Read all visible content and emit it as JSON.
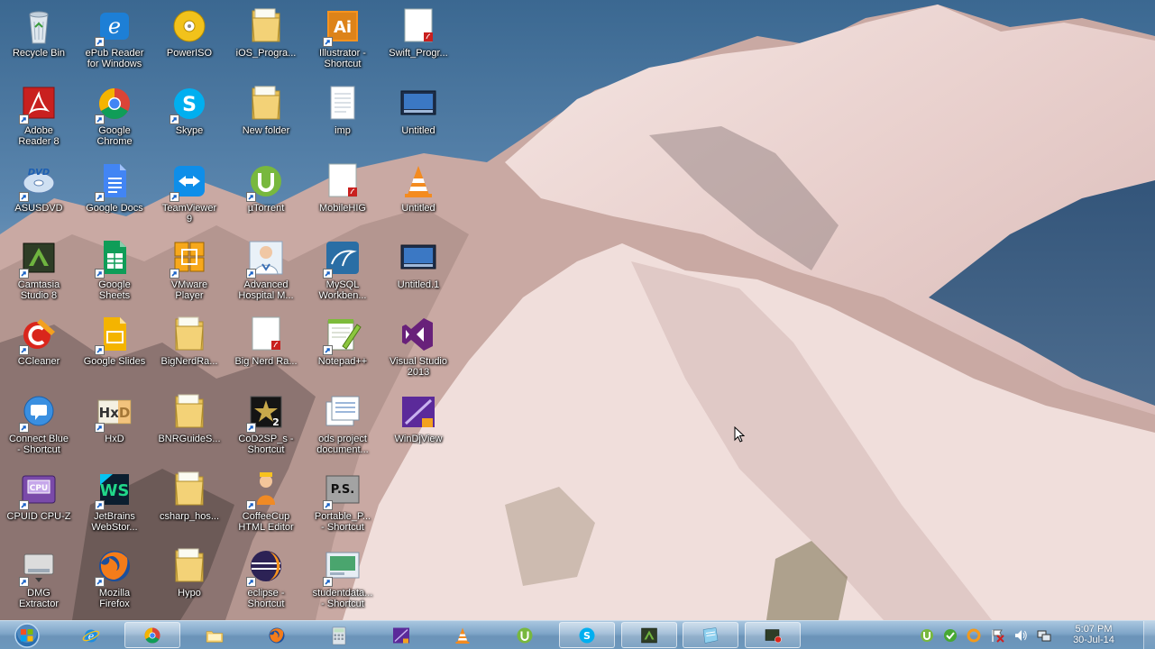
{
  "desktop": {
    "icons": [
      {
        "id": "recycle-bin",
        "label": "Recycle Bin",
        "icon": "recycle-bin-icon",
        "shortcut": false
      },
      {
        "id": "epub-reader",
        "label": "ePub Reader\nfor Windows",
        "icon": "epub-reader-icon",
        "shortcut": true
      },
      {
        "id": "poweriso",
        "label": "PowerISO",
        "icon": "poweriso-icon",
        "shortcut": false
      },
      {
        "id": "ios-programming",
        "label": "iOS_Progra...",
        "icon": "folder-icon",
        "shortcut": false
      },
      {
        "id": "illustrator",
        "label": "Illustrator -\nShortcut",
        "icon": "illustrator-icon",
        "shortcut": true
      },
      {
        "id": "swift-programming",
        "label": "Swift_Progr...",
        "icon": "pdf-document-icon",
        "shortcut": false
      },
      {
        "id": "adobe-reader",
        "label": "Adobe\nReader 8",
        "icon": "adobe-reader-icon",
        "shortcut": true
      },
      {
        "id": "google-chrome",
        "label": "Google\nChrome",
        "icon": "chrome-icon",
        "shortcut": true
      },
      {
        "id": "skype",
        "label": "Skype",
        "icon": "skype-icon",
        "shortcut": true
      },
      {
        "id": "new-folder",
        "label": "New folder",
        "icon": "folder-icon",
        "shortcut": false
      },
      {
        "id": "imp",
        "label": "imp",
        "icon": "text-document-icon",
        "shortcut": false
      },
      {
        "id": "untitled-1",
        "label": "Untitled",
        "icon": "video-thumbnail-icon",
        "shortcut": false
      },
      {
        "id": "asusdvd",
        "label": "ASUSDVD",
        "icon": "asus-dvd-icon",
        "shortcut": true
      },
      {
        "id": "google-docs",
        "label": "Google Docs",
        "icon": "google-docs-icon",
        "shortcut": true
      },
      {
        "id": "teamviewer",
        "label": "TeamViewer\n9",
        "icon": "teamviewer-icon",
        "shortcut": true
      },
      {
        "id": "utorrent",
        "label": "µTorrent",
        "icon": "utorrent-icon",
        "shortcut": true
      },
      {
        "id": "mobilehig",
        "label": "MobileHIG",
        "icon": "pdf-document-icon",
        "shortcut": false
      },
      {
        "id": "untitled-2",
        "label": "Untitled",
        "icon": "vlc-icon",
        "shortcut": false
      },
      {
        "id": "camtasia",
        "label": "Camtasia\nStudio 8",
        "icon": "camtasia-icon",
        "shortcut": true
      },
      {
        "id": "google-sheets",
        "label": "Google\nSheets",
        "icon": "google-sheets-icon",
        "shortcut": true
      },
      {
        "id": "vmware",
        "label": "VMware\nPlayer",
        "icon": "vmware-icon",
        "shortcut": true
      },
      {
        "id": "advanced-hospital",
        "label": "Advanced\nHospital M...",
        "icon": "doctor-icon",
        "shortcut": true
      },
      {
        "id": "mysql-workbench",
        "label": "MySQL\nWorkben...",
        "icon": "mysql-workbench-icon",
        "shortcut": true
      },
      {
        "id": "untitled-1-wmv",
        "label": "Untitled.1",
        "icon": "video-thumbnail-icon",
        "shortcut": false
      },
      {
        "id": "ccleaner",
        "label": "CCleaner",
        "icon": "ccleaner-icon",
        "shortcut": true
      },
      {
        "id": "google-slides",
        "label": "Google Slides",
        "icon": "google-slides-icon",
        "shortcut": true
      },
      {
        "id": "bignerdranch-1",
        "label": "BigNerdRa...",
        "icon": "folder-icon",
        "shortcut": false
      },
      {
        "id": "bignerdranch-2",
        "label": "Big Nerd Ra...",
        "icon": "pdf-document-icon",
        "shortcut": false
      },
      {
        "id": "notepad-plus",
        "label": "Notepad++",
        "icon": "notepad-plus-icon",
        "shortcut": true
      },
      {
        "id": "visual-studio",
        "label": "Visual Studio\n2013",
        "icon": "visual-studio-icon",
        "shortcut": false
      },
      {
        "id": "connect-blue",
        "label": "Connect Blue\n- Shortcut",
        "icon": "connect-blue-icon",
        "shortcut": true
      },
      {
        "id": "hxd",
        "label": "HxD",
        "icon": "hxd-icon",
        "shortcut": true
      },
      {
        "id": "bnr-guides",
        "label": "BNRGuideS...",
        "icon": "folder-icon",
        "shortcut": false
      },
      {
        "id": "cod2sp",
        "label": "CoD2SP_s -\nShortcut",
        "icon": "cod2-icon",
        "shortcut": true
      },
      {
        "id": "ods-project",
        "label": "ods project\ndocument...",
        "icon": "word-document-icon",
        "shortcut": false
      },
      {
        "id": "windjview",
        "label": "WinDjView",
        "icon": "windjview-icon",
        "shortcut": false
      },
      {
        "id": "cpuz",
        "label": "CPUID CPU-Z",
        "icon": "cpuz-icon",
        "shortcut": true
      },
      {
        "id": "webstorm",
        "label": "JetBrains\nWebStor...",
        "icon": "webstorm-icon",
        "shortcut": true
      },
      {
        "id": "csharp-host",
        "label": "csharp_hos...",
        "icon": "folder-icon",
        "shortcut": false
      },
      {
        "id": "coffeecup",
        "label": "CoffeeCup\nHTML Editor",
        "icon": "coffeecup-icon",
        "shortcut": true
      },
      {
        "id": "portable-ps",
        "label": "Portable_P...\n- Shortcut",
        "icon": "portable-ps-icon",
        "shortcut": true
      },
      {
        "id": "dmg-extractor",
        "label": "DMG\nExtractor",
        "icon": "dmg-extractor-icon",
        "shortcut": true
      },
      {
        "id": "mozilla-firefox",
        "label": "Mozilla\nFirefox",
        "icon": "firefox-icon",
        "shortcut": true
      },
      {
        "id": "hypo",
        "label": "Hypo",
        "icon": "folder-icon",
        "shortcut": false
      },
      {
        "id": "eclipse",
        "label": "eclipse -\nShortcut",
        "icon": "eclipse-icon",
        "shortcut": true
      },
      {
        "id": "studentdata",
        "label": "studentdata...\n- Shortcut",
        "icon": "studentdata-icon",
        "shortcut": true
      }
    ]
  },
  "taskbar": {
    "start_icon": "windows-start-orb-icon",
    "pinned": [
      {
        "id": "internet-explorer",
        "icon": "internet-explorer-icon",
        "active": false
      },
      {
        "id": "chrome",
        "icon": "chrome-icon",
        "active": true
      },
      {
        "id": "explorer",
        "icon": "file-explorer-icon",
        "active": false
      },
      {
        "id": "firefox",
        "icon": "firefox-icon",
        "active": false
      },
      {
        "id": "calculator",
        "icon": "calculator-icon",
        "active": false
      },
      {
        "id": "windjview",
        "icon": "windjview-icon",
        "active": false
      },
      {
        "id": "vlc",
        "icon": "vlc-icon",
        "active": false
      },
      {
        "id": "utorrent",
        "icon": "utorrent-icon",
        "active": false
      },
      {
        "id": "skype",
        "icon": "skype-icon",
        "active": true
      },
      {
        "id": "camtasia",
        "icon": "camtasia-icon",
        "active": true
      },
      {
        "id": "notes",
        "icon": "notes-app-icon",
        "active": true
      },
      {
        "id": "recorder",
        "icon": "camtasia-recorder-icon",
        "active": true
      }
    ],
    "tray": [
      {
        "id": "utorrent-tray",
        "icon": "utorrent-tray-icon"
      },
      {
        "id": "check-tray",
        "icon": "check-tray-icon"
      },
      {
        "id": "orange-tray",
        "icon": "orange-circle-tray-icon"
      },
      {
        "id": "flag-tray",
        "icon": "action-center-flag-icon"
      },
      {
        "id": "volume-tray",
        "icon": "volume-icon"
      },
      {
        "id": "network-tray",
        "icon": "network-icon"
      }
    ],
    "clock": {
      "time": "5:07 PM",
      "date": "30-Jul-14"
    }
  },
  "colors": {
    "taskbar": "#7ea5c8",
    "sky": "#3f6f9a",
    "snow": "#efd9d6"
  }
}
